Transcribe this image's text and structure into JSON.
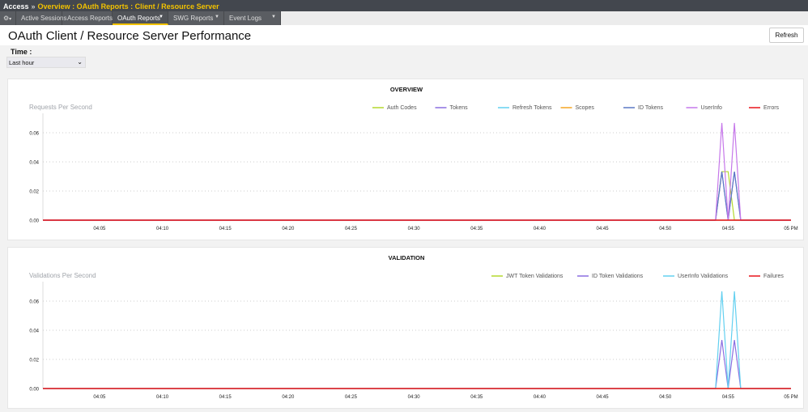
{
  "topbar": {
    "root": "Access",
    "separator": "»",
    "breadcrumb": "Overview : OAuth Reports : Client / Resource Server"
  },
  "tabs": [
    {
      "label": "",
      "icon": "gear-icon",
      "dropdown": true
    },
    {
      "label": "Active Sessions",
      "dropdown": false
    },
    {
      "label": "Access Reports",
      "dropdown": false
    },
    {
      "label": "OAuth Reports",
      "dropdown": true,
      "active": true
    },
    {
      "label": "SWG Reports",
      "dropdown": true
    },
    {
      "label": "Event Logs",
      "dropdown": true
    }
  ],
  "page": {
    "title": "OAuth Client / Resource Server Performance",
    "refresh_label": "Refresh"
  },
  "time": {
    "label": "Time :",
    "selected": "Last hour"
  },
  "chart_data": [
    {
      "type": "line",
      "title": "OVERVIEW",
      "ylabel": "Requests Per Second",
      "legend_position": "top-right",
      "grid": true,
      "ylim": [
        0,
        0.07
      ],
      "yticks": [
        "0.00",
        "0.02",
        "0.04",
        "0.06"
      ],
      "ytick_values": [
        0,
        0.02,
        0.04,
        0.06
      ],
      "xlim": [
        "04:00:30",
        "05:00:00"
      ],
      "xticks": [
        "04:05",
        "04:10",
        "04:15",
        "04:20",
        "04:25",
        "04:30",
        "04:35",
        "04:40",
        "04:45",
        "04:50",
        "04:55",
        "05 PM"
      ],
      "x": [
        "04:00:30",
        "04:54:00",
        "04:54:30",
        "04:55:00",
        "04:55:30",
        "04:56:00",
        "05:00:00"
      ],
      "series": [
        {
          "name": "Auth Codes",
          "color": "#b4d92e",
          "values": [
            0,
            0,
            0.0333,
            0.0333,
            0,
            0,
            0
          ]
        },
        {
          "name": "Tokens",
          "color": "#8b6ee0",
          "values": [
            0,
            0,
            0.0333,
            0,
            0.0333,
            0,
            0
          ]
        },
        {
          "name": "Refresh Tokens",
          "color": "#63d0f0",
          "values": [
            0,
            0,
            0,
            0,
            0,
            0,
            0
          ]
        },
        {
          "name": "Scopes",
          "color": "#f5a623",
          "values": [
            0,
            0,
            0,
            0,
            0,
            0,
            0
          ]
        },
        {
          "name": "ID Tokens",
          "color": "#5b79c4",
          "values": [
            0,
            0,
            0.0333,
            0,
            0.0333,
            0,
            0
          ]
        },
        {
          "name": "UserInfo",
          "color": "#c678ea",
          "values": [
            0,
            0,
            0.0667,
            0,
            0.0667,
            0,
            0
          ]
        },
        {
          "name": "Errors",
          "color": "#e8141b",
          "values": [
            0,
            0,
            0,
            0,
            0,
            0,
            0
          ]
        }
      ]
    },
    {
      "type": "line",
      "title": "VALIDATION",
      "ylabel": "Validations Per Second",
      "legend_position": "top-right",
      "grid": true,
      "ylim": [
        0,
        0.07
      ],
      "yticks": [
        "0.00",
        "0.02",
        "0.04",
        "0.06"
      ],
      "ytick_values": [
        0,
        0.02,
        0.04,
        0.06
      ],
      "xlim": [
        "04:00:30",
        "05:00:00"
      ],
      "xticks": [
        "04:05",
        "04:10",
        "04:15",
        "04:20",
        "04:25",
        "04:30",
        "04:35",
        "04:40",
        "04:45",
        "04:50",
        "04:55",
        "05 PM"
      ],
      "x": [
        "04:00:30",
        "04:54:00",
        "04:54:30",
        "04:55:00",
        "04:55:30",
        "04:56:00",
        "05:00:00"
      ],
      "series": [
        {
          "name": "JWT Token Validations",
          "color": "#b4d92e",
          "values": [
            0,
            0,
            0,
            0,
            0,
            0,
            0
          ]
        },
        {
          "name": "ID Token Validations",
          "color": "#8b6ee0",
          "values": [
            0,
            0,
            0.0333,
            0,
            0.0333,
            0,
            0
          ]
        },
        {
          "name": "UserInfo Validations",
          "color": "#63d0f0",
          "values": [
            0,
            0,
            0.0667,
            0,
            0.0667,
            0,
            0
          ]
        },
        {
          "name": "Failures",
          "color": "#e8141b",
          "values": [
            0,
            0,
            0,
            0,
            0,
            0,
            0
          ]
        }
      ]
    }
  ]
}
